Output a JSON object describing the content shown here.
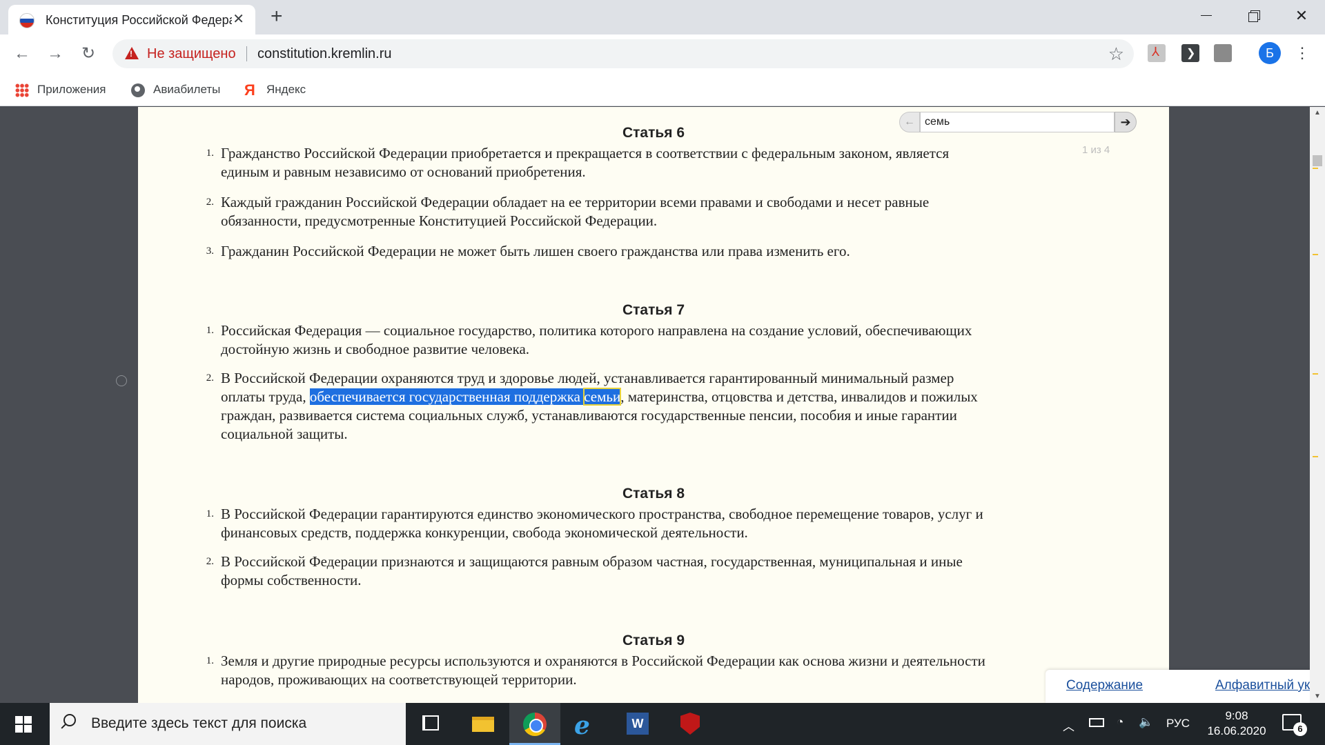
{
  "browser": {
    "tab_title": "Конституция Российской Федерации",
    "tab_close": "✕",
    "new_tab": "+",
    "not_secure": "Не защищено",
    "url": "constitution.kremlin.ru",
    "profile_initial": "Б",
    "bookmarks": [
      {
        "label": "Приложения",
        "icon": "apps-grid-icon"
      },
      {
        "label": "Авиабилеты",
        "icon": "globe-icon"
      },
      {
        "label": "Яндекс",
        "icon": "yandex-icon"
      }
    ],
    "yandex_glyph": "Я"
  },
  "find": {
    "query": "семь",
    "count": "1 из 4"
  },
  "articles": [
    {
      "title": "Статья 6",
      "items": [
        {
          "num": "1.",
          "text": "Гражданство Российской Федерации приобретается и прекращается в соответствии с федеральным законом, является единым и равным независимо от оснований приобретения."
        },
        {
          "num": "2.",
          "text": "Каждый гражданин Российской Федерации обладает на ее территории всеми правами и свободами и несет равные обязанности, предусмотренные Конституцией Российской Федерации."
        },
        {
          "num": "3.",
          "text": "Гражданин Российской Федерации не может быть лишен своего гражданства или права изменить его."
        }
      ]
    },
    {
      "title": "Статья 7",
      "items": [
        {
          "num": "1.",
          "text": "Российская Федерация — социальное государство, политика которого направлена на создание условий, обеспечивающих достойную жизнь и свободное развитие человека."
        },
        {
          "num": "2.",
          "text_before": "В Российской Федерации охраняются труд и здоровье людей, устанавливается гарантированный минимальный размер оплаты труда, ",
          "text_selected": "обеспечивается государственная поддержка ",
          "text_match": "семьи",
          "text_after": ", материнства, отцовства и детства, инвалидов и пожилых граждан, развивается система социальных служб, устанавливаются государственные пенсии, пособия и иные гарантии социальной защиты."
        }
      ]
    },
    {
      "title": "Статья 8",
      "items": [
        {
          "num": "1.",
          "text": "В Российской Федерации гарантируются единство экономического пространства, свободное перемещение товаров, услуг и финансовых средств, поддержка конкуренции, свобода экономической деятельности."
        },
        {
          "num": "2.",
          "text": "В Российской Федерации признаются и защищаются равным образом частная, государственная, муниципальная и иные формы собственности."
        }
      ]
    },
    {
      "title": "Статья 9",
      "items": [
        {
          "num": "1.",
          "text": "Земля и другие природные ресурсы используются и охраняются в Российской Федерации как основа жизни и деятельности народов, проживающих на соответствующей территории."
        }
      ]
    }
  ],
  "links": {
    "contents": "Содержание",
    "index": "Алфавитный указатель"
  },
  "taskbar": {
    "search_placeholder": "Введите здесь текст для поиска",
    "language": "РУС",
    "time": "9:08",
    "date": "16.06.2020",
    "notifications": "6"
  }
}
